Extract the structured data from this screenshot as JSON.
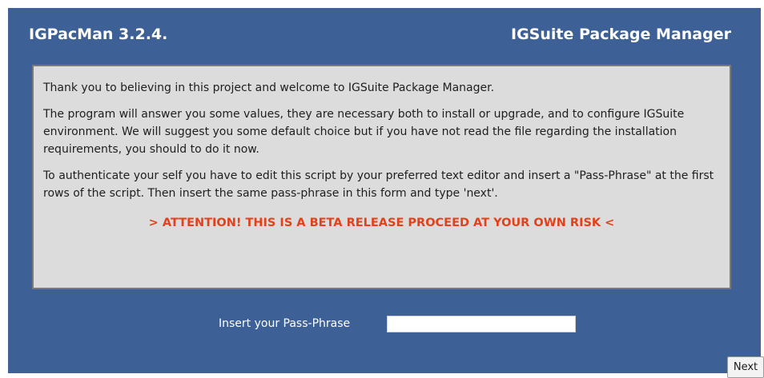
{
  "header": {
    "app_title": "IGPacMan 3.2.4.",
    "app_subtitle": "IGSuite Package Manager"
  },
  "message": {
    "paragraphs": [
      "Thank you to believing in this project and welcome to IGSuite Package Manager.",
      "The program will answer you some values, they are necessary both to install or upgrade, and to configure IGSuite environment. We will suggest you some default choice but if you have not read the file regarding the installation requirements, you should to do it now.",
      "To authenticate your self you have to edit this script by your preferred text editor and insert a \"Pass-Phrase\" at the first rows of the script. Then insert the same pass-phrase in this form and type 'next'."
    ],
    "warning": "> ATTENTION! THIS IS A BETA RELEASE PROCEED AT YOUR OWN RISK <"
  },
  "form": {
    "pass_phrase_label": "Insert your Pass-Phrase",
    "pass_phrase_value": "",
    "next_label": "Next"
  },
  "colors": {
    "background": "#3d6196",
    "panel": "#dcdcdc",
    "warning": "#e4401a",
    "text_light": "#ffffff"
  }
}
